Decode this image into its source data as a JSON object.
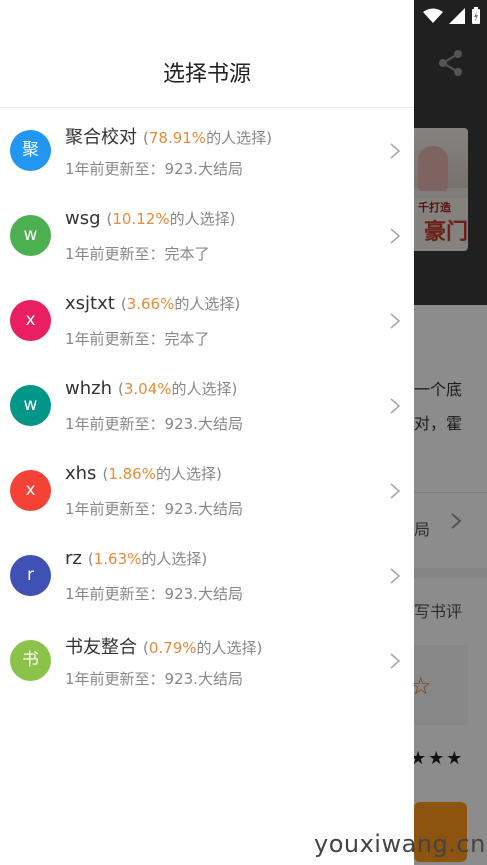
{
  "drawer": {
    "title": "选择书源",
    "sources": [
      {
        "avatar": "聚",
        "color": "#2196f3",
        "name": "聚合校对",
        "percent": "78.91%",
        "pct_suffix": "的人选择)",
        "update": "1年前更新至：923.大结局"
      },
      {
        "avatar": "w",
        "color": "#4caf50",
        "name": "wsg",
        "percent": "10.12%",
        "pct_suffix": "的人选择)",
        "update": "1年前更新至：完本了"
      },
      {
        "avatar": "x",
        "color": "#e91e63",
        "name": "xsjtxt",
        "percent": "3.66%",
        "pct_suffix": "的人选择)",
        "update": "1年前更新至：完本了"
      },
      {
        "avatar": "w",
        "color": "#009688",
        "name": "whzh",
        "percent": "3.04%",
        "pct_suffix": "的人选择)",
        "update": "1年前更新至：923.大结局"
      },
      {
        "avatar": "x",
        "color": "#f44336",
        "name": "xhs",
        "percent": "1.86%",
        "pct_suffix": "的人选择)",
        "update": "1年前更新至：923.大结局"
      },
      {
        "avatar": "r",
        "color": "#3f51b5",
        "name": "rz",
        "percent": "1.63%",
        "pct_suffix": "的人选择)",
        "update": "1年前更新至：923.大结局"
      },
      {
        "avatar": "书",
        "color": "#8bc34a",
        "name": "书友整合",
        "percent": "0.79%",
        "pct_suffix": "的人选择)",
        "update": "1年前更新至：923.大结局"
      }
    ]
  },
  "background": {
    "cover_title": "千打造",
    "cover_big": "豪门",
    "desc_line1": "一个底",
    "desc_line2": "对，霍",
    "latest_chapter": "局",
    "write_review": "写书评"
  },
  "watermark": "youxiwang.cn",
  "icons": {
    "share": "share-icon",
    "wifi": "wifi-icon",
    "signal": "signal-icon",
    "battery": "battery-charging-icon",
    "chevron": "chevron-right-icon"
  }
}
